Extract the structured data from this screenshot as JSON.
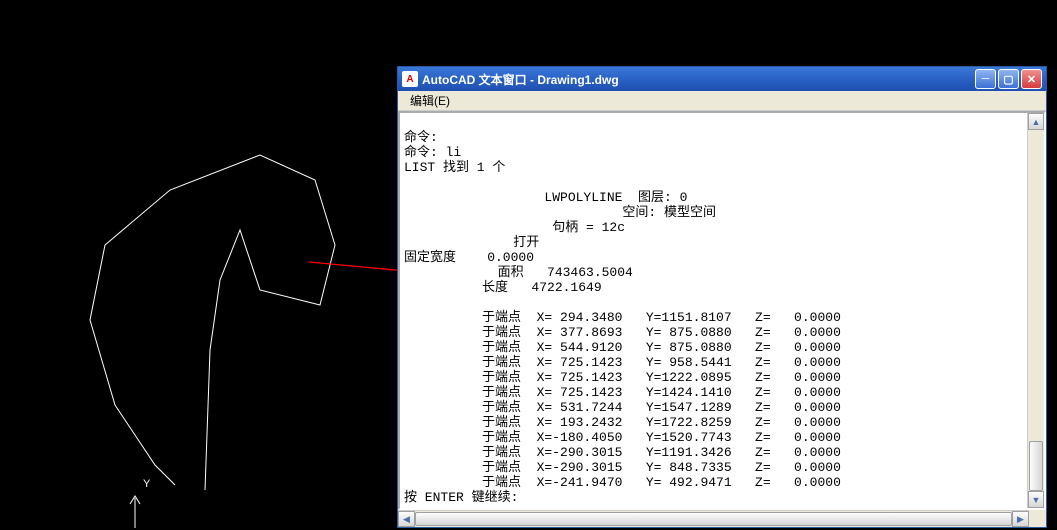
{
  "window": {
    "title": "AutoCAD 文本窗口 - Drawing1.dwg",
    "appicon_text": "A"
  },
  "menu": {
    "edit": "编辑(E)"
  },
  "terminal": {
    "line_cmd1": "命令:",
    "line_cmd2": "命令: li",
    "line_list": "LIST 找到 1 个",
    "blank": "",
    "line_lwpoly": "                  LWPOLYLINE  图层: 0",
    "line_space": "                            空间: 模型空间",
    "line_handle": "                   句柄 = 12c",
    "line_open": "              打开",
    "line_fixwidth": "固定宽度    0.0000",
    "line_area": "            面积   743463.5004",
    "line_length": "          长度   4722.1649",
    "pt0": "          于端点  X= 294.3480   Y=1151.8107   Z=   0.0000",
    "pt1": "          于端点  X= 377.8693   Y= 875.0880   Z=   0.0000",
    "pt2": "          于端点  X= 544.9120   Y= 875.0880   Z=   0.0000",
    "pt3": "          于端点  X= 725.1423   Y= 958.5441   Z=   0.0000",
    "pt4": "          于端点  X= 725.1423   Y=1222.0895   Z=   0.0000",
    "pt5": "          于端点  X= 725.1423   Y=1424.1410   Z=   0.0000",
    "pt6": "          于端点  X= 531.7244   Y=1547.1289   Z=   0.0000",
    "pt7": "          于端点  X= 193.2432   Y=1722.8259   Z=   0.0000",
    "pt8": "          于端点  X=-180.4050   Y=1520.7743   Z=   0.0000",
    "pt9": "          于端点  X=-290.3015   Y=1191.3426   Z=   0.0000",
    "pt10": "          于端点  X=-290.3015   Y= 848.7335   Z=   0.0000",
    "pt11": "          于端点  X=-241.9470   Y= 492.9471   Z=   0.0000",
    "prompt": "按 ENTER 键继续:"
  },
  "canvas": {
    "ucs_label": "Y"
  }
}
